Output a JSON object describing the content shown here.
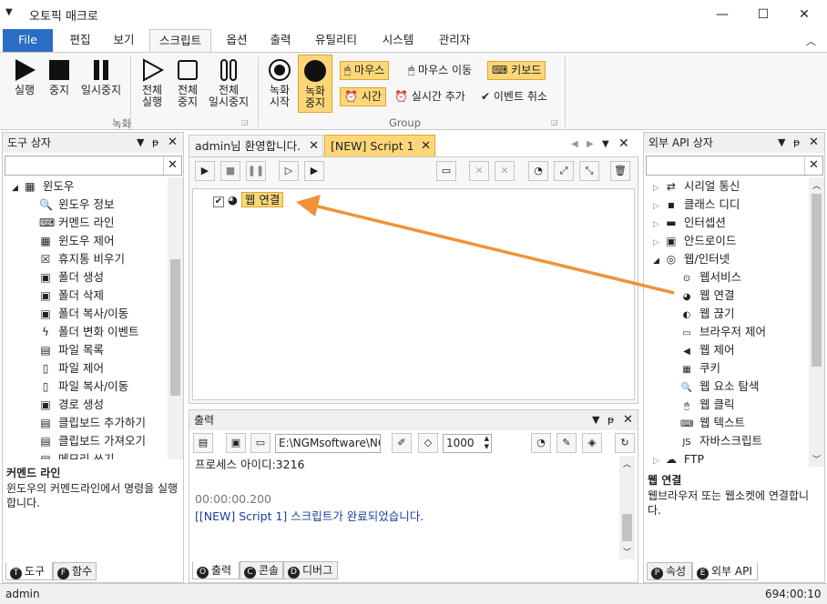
{
  "window": {
    "title": "오토픽 매크로",
    "controls": [
      "—",
      "☐",
      "✕"
    ]
  },
  "ribbon_tabs": [
    "File",
    "편집",
    "보기",
    "스크립트",
    "옵션",
    "출력",
    "유틸리티",
    "시스템",
    "관리자"
  ],
  "ribbon": {
    "run": "실행",
    "stop": "중지",
    "pause": "일시중지",
    "all_run_1": "전체",
    "all_run_2": "실행",
    "all_stop_1": "전체",
    "all_stop_2": "중지",
    "all_pause_1": "전체",
    "all_pause_2": "일시중지",
    "group_record": "녹화",
    "rec_start_1": "녹화",
    "rec_start_2": "시작",
    "rec_stop_1": "녹화",
    "rec_stop_2": "중지",
    "mouse": "마우스",
    "mouse_move": "마우스 이동",
    "keyboard": "키보드",
    "time": "시간",
    "realtime_add": "실시간 추가",
    "event_cancel": "이벤트 취소",
    "group_label": "Group"
  },
  "toolbox": {
    "title": "도구 상자",
    "category": "윈도우",
    "items": [
      "윈도우 정보",
      "커멘드 라인",
      "윈도우 제어",
      "휴지통 비우기",
      "폴더 생성",
      "폴더 삭제",
      "폴더 복사/이동",
      "폴더 변화 이벤트",
      "파일 목록",
      "파일 제어",
      "파일 복사/이동",
      "경로 생성",
      "클립보드 추가하기",
      "클립보드 가져오기",
      "메모리 쓰기"
    ],
    "desc_title": "커멘드 라인",
    "desc_text": "윈도우의 커멘드라인에서 명령을 실행합니다.",
    "tab_tools": "도구",
    "tab_funcs": "함수"
  },
  "editor": {
    "tab_welcome": "admin님 환영합니다.",
    "tab_script": "[NEW] Script 1",
    "node_label": "웹 연결"
  },
  "output": {
    "title": "출력",
    "path": "E:\\NGMsoftware\\NG",
    "interval": "1000",
    "lines": [
      "프로세스 아이디:3216",
      "",
      "00:00:00.200",
      "[[NEW] Script 1] 스크립트가 완료되었습니다."
    ],
    "tab_output": "출력",
    "tab_console": "콘솔",
    "tab_debug": "디버그"
  },
  "api": {
    "title": "외부 API 상자",
    "top_items": [
      "시리얼 통신",
      "클래스 디디",
      "인터셉션",
      "안드로이드"
    ],
    "web_category": "웹/인터넷",
    "web_items": [
      "웹서비스",
      "웹 연결",
      "웹 끊기",
      "브라우저 제어",
      "웹 제어",
      "쿠키",
      "웹 요소 탐색",
      "웹 클릭",
      "웹 텍스트",
      "자바스크립트"
    ],
    "last_item": "FTP",
    "desc_title": "웹 연결",
    "desc_text": "웹브라우저 또는 웹소켓에 연결합니다.",
    "tab_props": "속성",
    "tab_api": "외부 API"
  },
  "status": {
    "user": "admin",
    "clock": "694:00:10"
  },
  "colors": {
    "accent": "#2b6cc4",
    "highlight": "#fbd77a",
    "arrow": "#f0923a",
    "link": "#1a3fa0"
  }
}
